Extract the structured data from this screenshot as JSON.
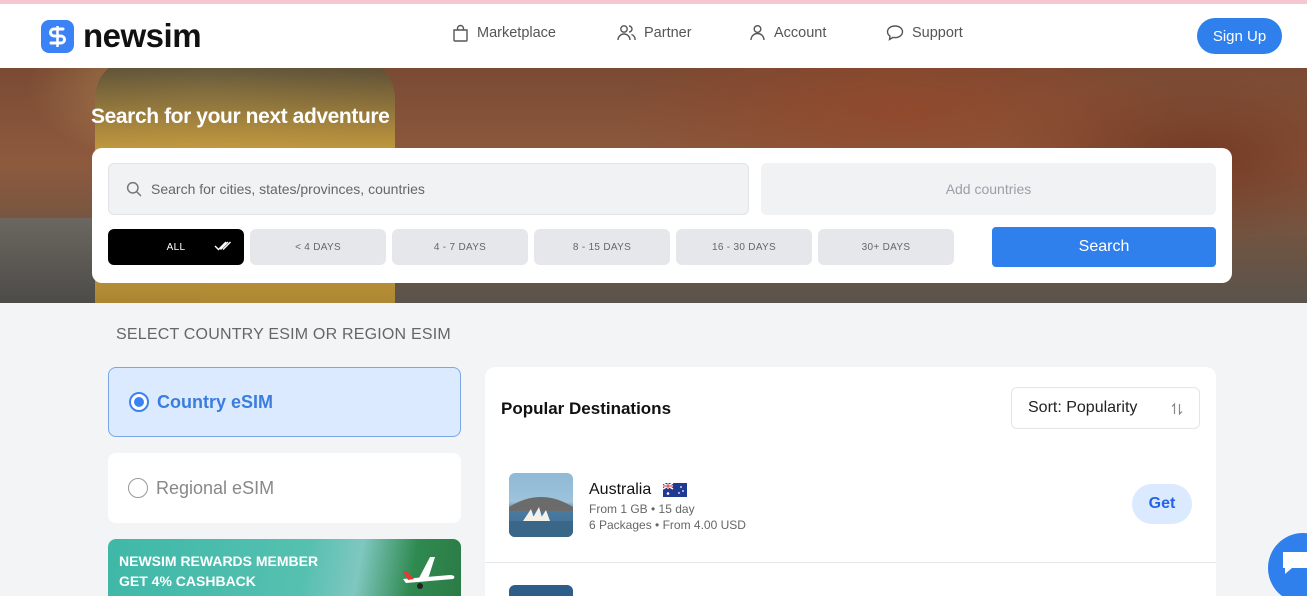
{
  "header": {
    "logo_text": "newsim",
    "nav": [
      {
        "label": "Marketplace",
        "icon": "bag-icon"
      },
      {
        "label": "Partner",
        "icon": "users-icon"
      },
      {
        "label": "Account",
        "icon": "user-icon"
      },
      {
        "label": "Support",
        "icon": "chat-icon"
      }
    ],
    "signup_label": "Sign Up"
  },
  "hero": {
    "title": "Search for your next adventure",
    "search_placeholder": "Search for cities, states/provinces, countries",
    "add_countries": "Add countries",
    "duration_chips": [
      "ALL",
      "< 4 DAYS",
      "4 - 7 DAYS",
      "8 - 15 DAYS",
      "16 - 30 DAYS",
      "30+ DAYS"
    ],
    "active_chip": "ALL",
    "search_button": "Search"
  },
  "selector": {
    "label": "SELECT COUNTRY ESIM OR REGION ESIM",
    "options": [
      "Country eSIM",
      "Regional eSIM"
    ],
    "selected": "Country eSIM"
  },
  "promo": {
    "line1": "NEWSIM REWARDS MEMBER",
    "line2": "GET 4% CASHBACK"
  },
  "destinations": {
    "title": "Popular Destinations",
    "sort_label": "Sort: Popularity",
    "items": [
      {
        "name": "Australia",
        "sub1": "From 1 GB • 15 day",
        "sub2": "6 Packages • From 4.00 USD",
        "action": "Get"
      }
    ]
  },
  "colors": {
    "accent": "#2f80ed",
    "selected_bg": "#dbeafe",
    "chip_active": "#000000"
  }
}
